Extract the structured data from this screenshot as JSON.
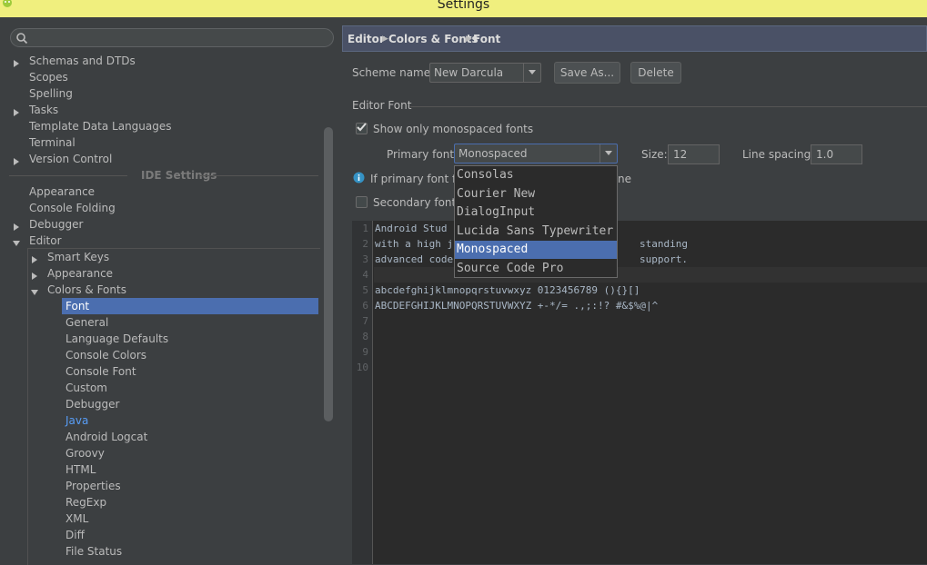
{
  "window": {
    "title": "Settings"
  },
  "search": {
    "placeholder": ""
  },
  "tree": {
    "rows": [
      {
        "label": "Schemas and DTDs",
        "arrow": true
      },
      {
        "label": "Scopes",
        "arrow": false
      },
      {
        "label": "Spelling",
        "arrow": false
      },
      {
        "label": "Tasks",
        "arrow": true
      },
      {
        "label": "Template Data Languages",
        "arrow": false
      },
      {
        "label": "Terminal",
        "arrow": false
      },
      {
        "label": "Version Control",
        "arrow": true
      }
    ],
    "section": "IDE Settings",
    "ide_rows": [
      {
        "label": "Appearance"
      },
      {
        "label": "Console Folding"
      },
      {
        "label": "Debugger"
      },
      {
        "label": "Editor"
      }
    ],
    "editor_rows": [
      {
        "label": "Smart Keys"
      },
      {
        "label": "Appearance"
      },
      {
        "label": "Colors & Fonts"
      }
    ],
    "color_rows": [
      {
        "label": "Font"
      },
      {
        "label": "General"
      },
      {
        "label": "Language Defaults"
      },
      {
        "label": "Console Colors"
      },
      {
        "label": "Console Font"
      },
      {
        "label": "Custom"
      },
      {
        "label": "Debugger"
      },
      {
        "label": "Java"
      },
      {
        "label": "Android Logcat"
      },
      {
        "label": "Groovy"
      },
      {
        "label": "HTML"
      },
      {
        "label": "Properties"
      },
      {
        "label": "RegExp"
      },
      {
        "label": "XML"
      },
      {
        "label": "Diff"
      },
      {
        "label": "File Status"
      }
    ]
  },
  "breadcrumb": [
    "Editor",
    "Colors & Fonts",
    "Font"
  ],
  "scheme": {
    "label": "Scheme name:",
    "value": "New Darcula",
    "save_as": "Save As...",
    "delete": "Delete"
  },
  "editor_font": {
    "group_title": "Editor Font",
    "show_mono_label": "Show only monospaced fonts",
    "show_mono_checked": true,
    "primary_label": "Primary font:",
    "primary_value": "Monospaced",
    "size_label": "Size:",
    "size_value": "12",
    "spacing_label": "Line spacing:",
    "spacing_value": "1.0",
    "info_text_start": "If primary font fai",
    "info_text_end": "ne",
    "secondary_label": "Secondary font:",
    "secondary_checked": false
  },
  "font_options": [
    "Consolas",
    "Courier New",
    "DialogInput",
    "Lucida Sans Typewriter",
    "Monospaced",
    "Source Code Pro"
  ],
  "selected_font_index": 4,
  "preview": {
    "line_numbers": [
      "1",
      "2",
      "3",
      "4",
      "5",
      "6",
      "7",
      "8",
      "9",
      "10"
    ],
    "lines": [
      "Android Stud",
      "with a high j",
      "advanced code",
      "",
      "abcdefghijklmnopqrstuvwxyz 0123456789 (){}[]",
      "ABCDEFGHIJKLMNOPQRSTUVWXYZ +-*/= .,;:!? #&$%@|^",
      "",
      "",
      "",
      ""
    ],
    "line1_tail": "",
    "line2_tail": "standing",
    "line3_tail": "support."
  },
  "colors": {
    "accent": "#4b6eaf",
    "background": "#3c3f41",
    "titlebar": "#f0ef7e"
  }
}
